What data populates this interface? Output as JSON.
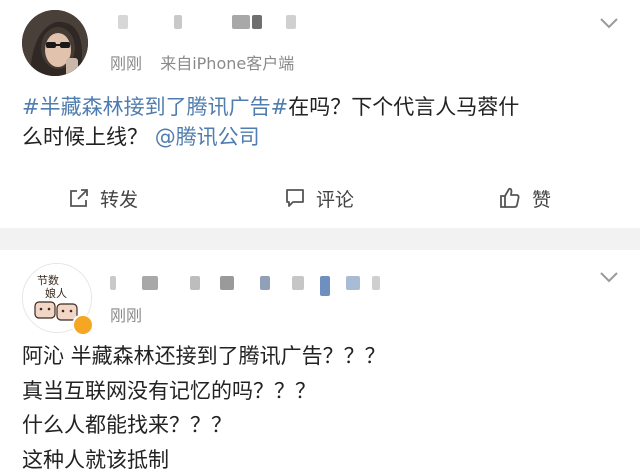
{
  "post": {
    "time": "刚刚",
    "source": "来自iPhone客户端",
    "hashtag": "#半藏森林接到了腾讯广告#",
    "text_after_tag_line1": "在吗？下个代言人马蓉什",
    "text_line2_plain": "么时候上线？",
    "mention": "@腾讯公司",
    "actions": {
      "repost": "转发",
      "comment": "评论",
      "like": "赞"
    }
  },
  "comment": {
    "time": "刚刚",
    "avatar_text": [
      "节数",
      "娘人"
    ],
    "lines": [
      "阿沁  半藏森林还接到了腾讯广告？？？",
      "真当互联网没有记忆的吗？？？",
      "什么人都能找来？？？",
      "这种人就该抵制"
    ]
  },
  "colors": {
    "link": "#507daf",
    "meta": "#8a8a8a",
    "separator": "#f2f2f2",
    "badge": "#f5a623"
  }
}
